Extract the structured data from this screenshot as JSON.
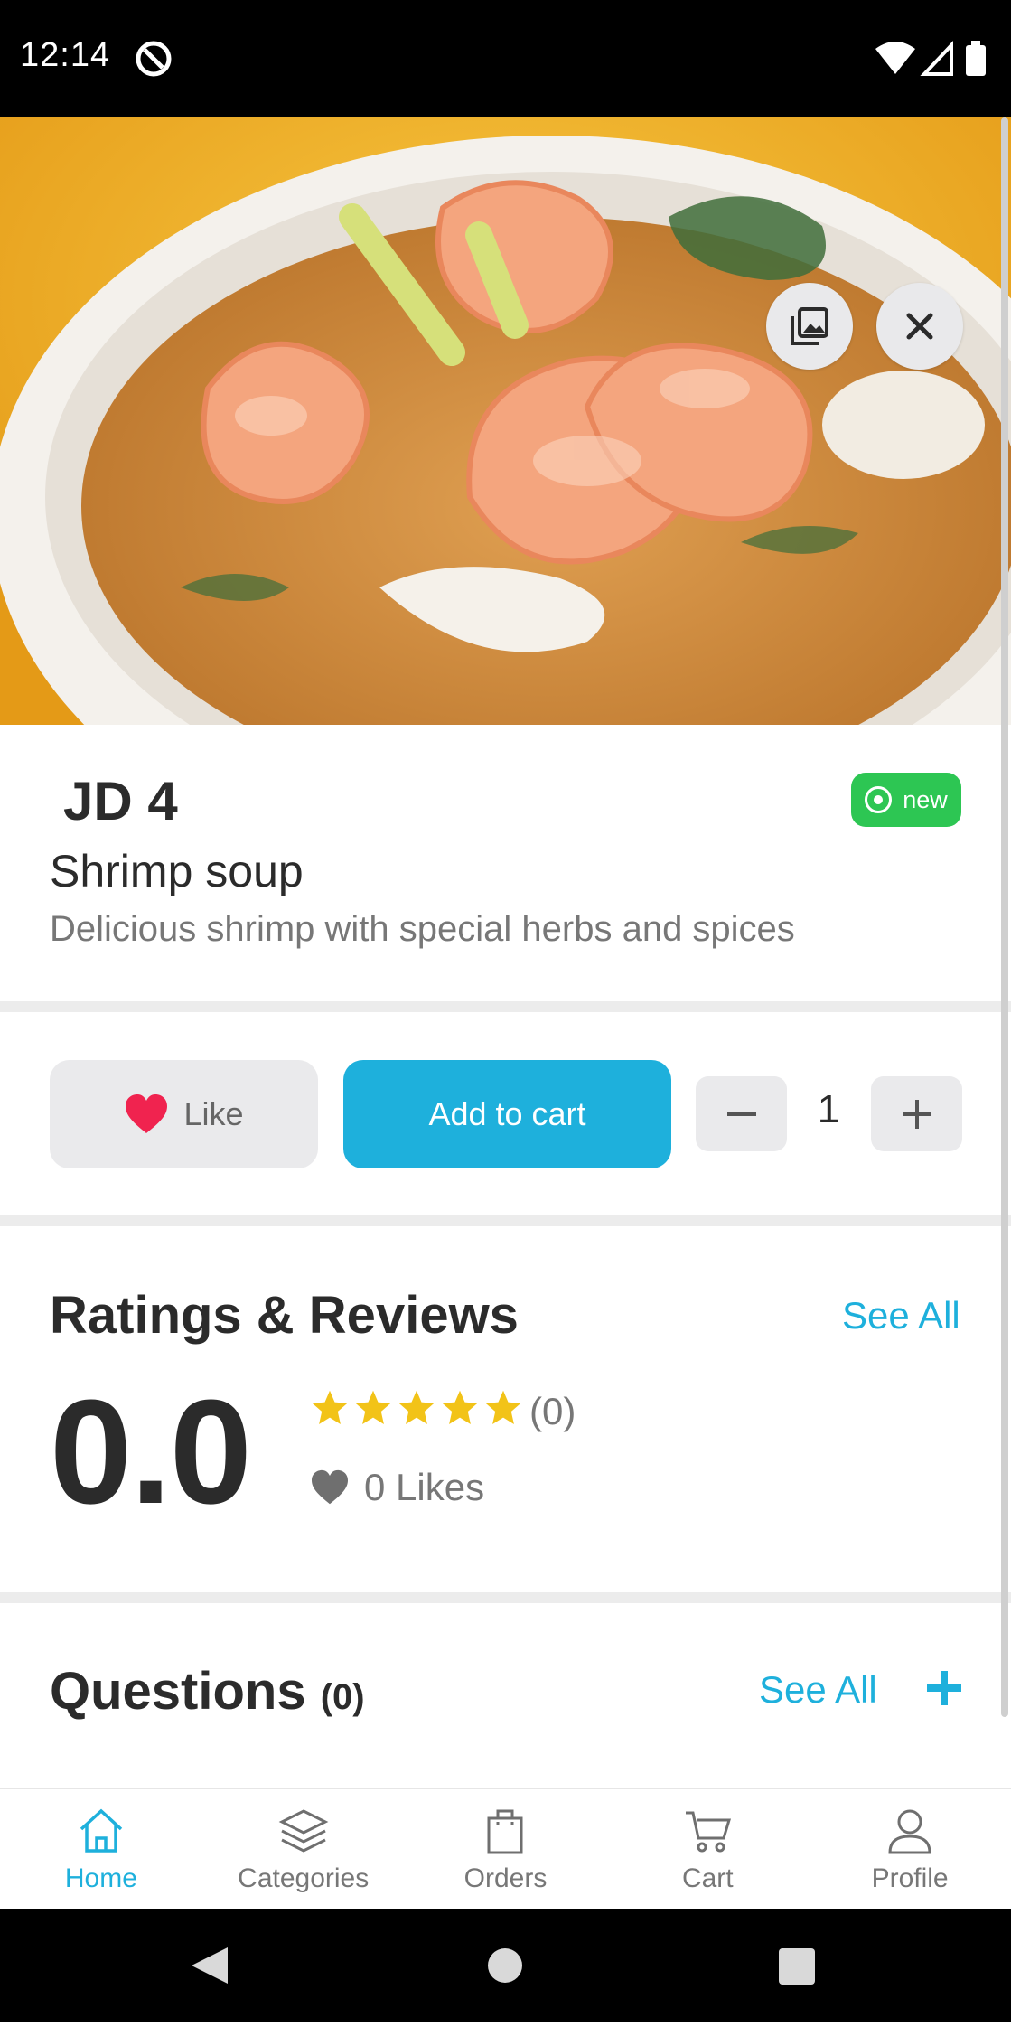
{
  "status_bar": {
    "time": "12:14"
  },
  "product": {
    "price": "JD 4",
    "badge": "new",
    "name": "Shrimp soup",
    "description": "Delicious shrimp with special herbs and spices"
  },
  "actions": {
    "like_label": "Like",
    "add_to_cart_label": "Add to cart",
    "quantity": "1"
  },
  "ratings": {
    "title": "Ratings & Reviews",
    "see_all": "See All",
    "score": "0.0",
    "review_count": "(0)",
    "likes": "0 Likes",
    "stars": 5
  },
  "questions": {
    "title": "Questions",
    "count": "(0)",
    "see_all": "See All"
  },
  "bottom_nav": [
    {
      "label": "Home",
      "icon": "home-icon",
      "active": true
    },
    {
      "label": "Categories",
      "icon": "layers-icon",
      "active": false
    },
    {
      "label": "Orders",
      "icon": "bag-icon",
      "active": false
    },
    {
      "label": "Cart",
      "icon": "cart-icon",
      "active": false
    },
    {
      "label": "Profile",
      "icon": "user-icon",
      "active": false
    }
  ],
  "colors": {
    "accent": "#1eb0dc",
    "badge_green": "#2dc653",
    "star_yellow": "#f2c318",
    "heart_red": "#f0234f"
  }
}
